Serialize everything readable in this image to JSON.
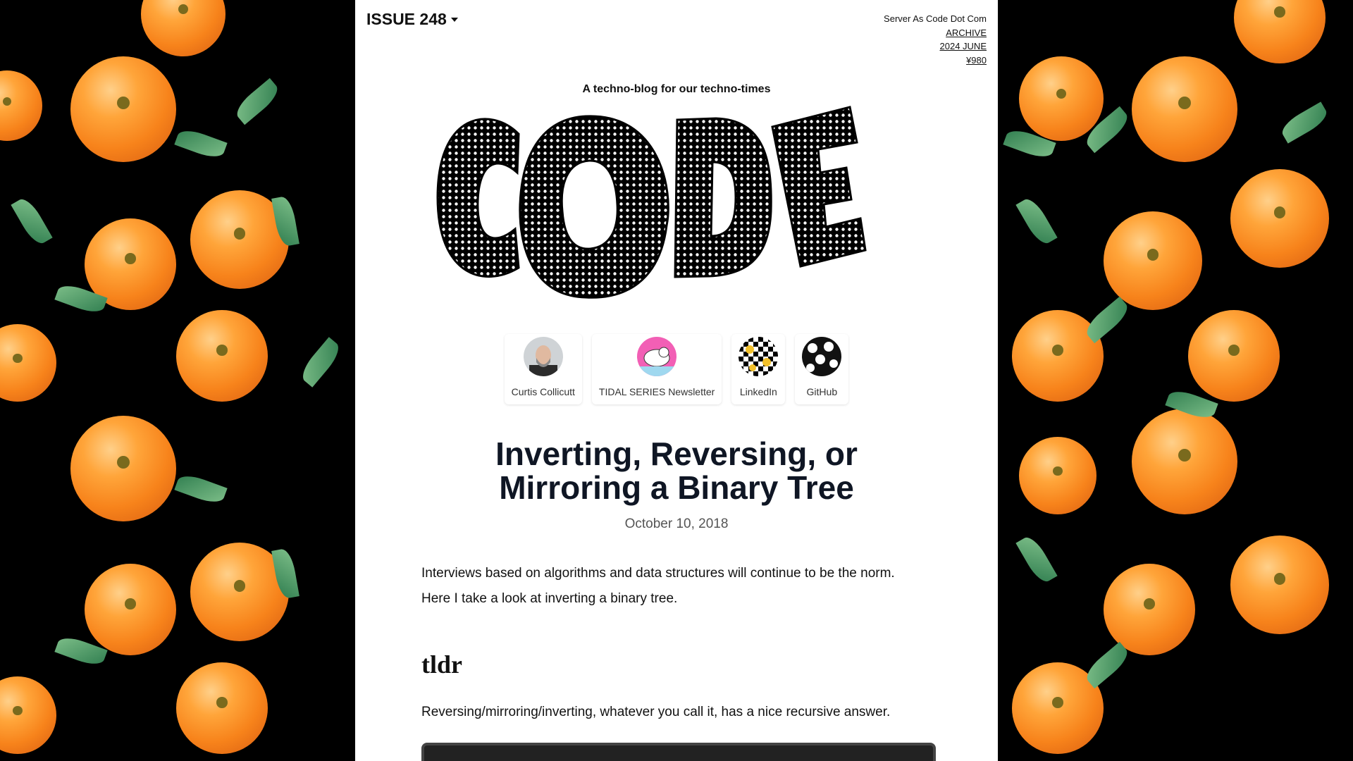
{
  "header": {
    "issue_label": "ISSUE 248",
    "site_name": "Server As Code Dot Com",
    "archive_link": "ARCHIVE",
    "date_link": "2024 JUNE",
    "price_link": "¥980"
  },
  "tagline": "A techno-blog for our techno-times",
  "logo_text": "CODE",
  "profile_links": [
    {
      "label": "Curtis Collicutt",
      "icon": "curtis-avatar-icon"
    },
    {
      "label": "TIDAL SERIES Newsletter",
      "icon": "polar-bear-icon"
    },
    {
      "label": "LinkedIn",
      "icon": "checkered-smiley-icon"
    },
    {
      "label": "GitHub",
      "icon": "ghost-pattern-icon"
    }
  ],
  "article": {
    "title_line1": "Inverting, Reversing, or",
    "title_line2": "Mirroring a Binary Tree",
    "date": "October 10, 2018",
    "intro_line1": "Interviews based on algorithms and data structures will continue to be the norm.",
    "intro_line2": "Here I take a look at inverting a binary tree.",
    "section_heading": "tldr",
    "tldr_text": "Reversing/mirroring/inverting, whatever you call it, has a nice recursive answer."
  },
  "colors": {
    "background": "#000000",
    "page": "#ffffff",
    "orange": "#f7831b",
    "leaf": "#2f7d4f",
    "title": "#0f1624"
  }
}
